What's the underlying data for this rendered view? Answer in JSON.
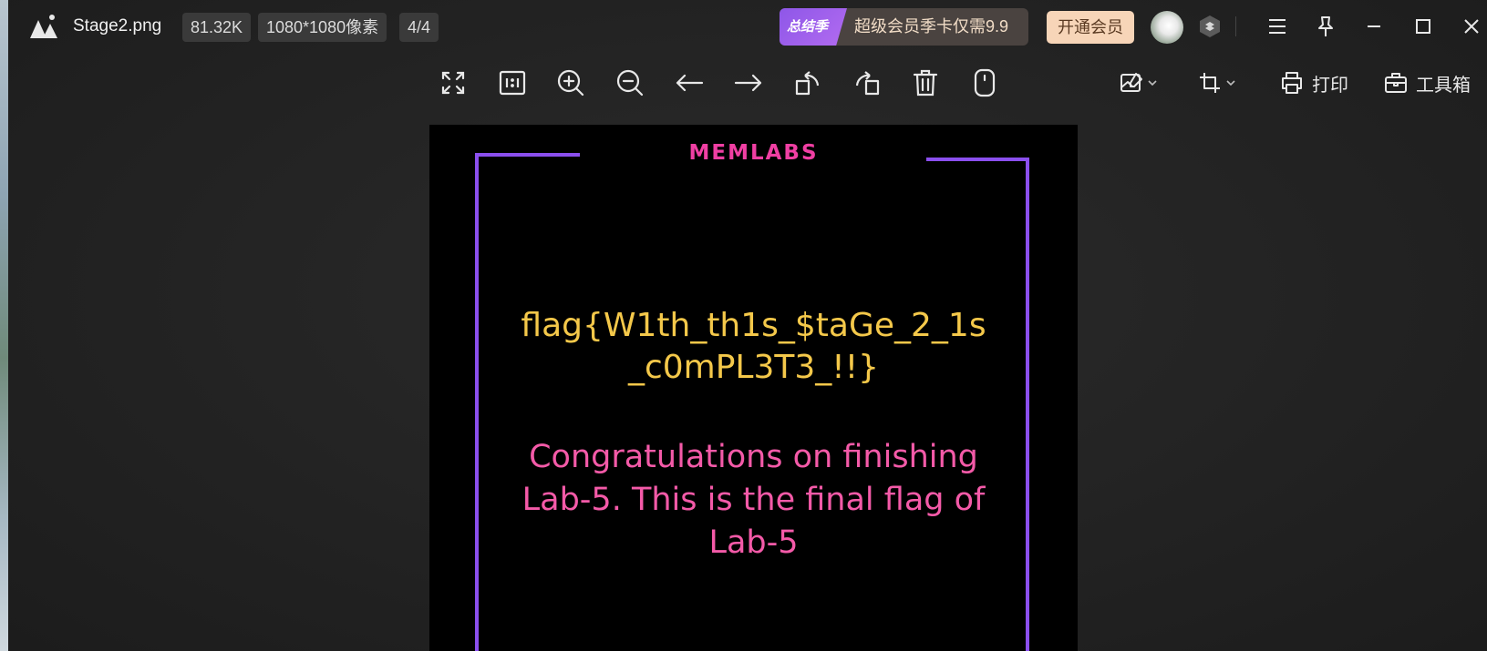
{
  "window": {
    "filename": "Stage2.png",
    "file_size": "81.32K",
    "dimensions": "1080*1080像素",
    "page_counter": "4/4"
  },
  "promo": {
    "tag": "总结季",
    "text": "超级会员季卡仅需9.9"
  },
  "vip_button": "开通会员",
  "toolbar_right": {
    "print_label": "打印",
    "toolbox_label": "工具箱"
  },
  "image_content": {
    "brand": "MEMLABS",
    "flag_text": "flag{W1th_th1s_$taGe_2_1s_c0mPL3T3_!!}",
    "message": "Congratulations on finishing Lab-5. This is the final flag of Lab-5"
  },
  "colors": {
    "frame": "#8b4fee",
    "brand": "#f03fa3",
    "flag": "#f4c84a",
    "message": "#f45aa8",
    "vip_button_bg": "#f7d5b8",
    "promo_tag_bg": "#8e57e8"
  },
  "icons": {
    "toolbar": [
      "fit-screen-icon",
      "actual-size-icon",
      "zoom-in-icon",
      "zoom-out-icon",
      "previous-icon",
      "next-icon",
      "rotate-left-icon",
      "rotate-right-icon",
      "delete-icon",
      "mouse-icon"
    ],
    "titlebar": [
      "app-logo-icon",
      "skin-icon",
      "menu-icon",
      "pin-icon",
      "minimize-icon",
      "maximize-icon",
      "close-icon"
    ]
  }
}
